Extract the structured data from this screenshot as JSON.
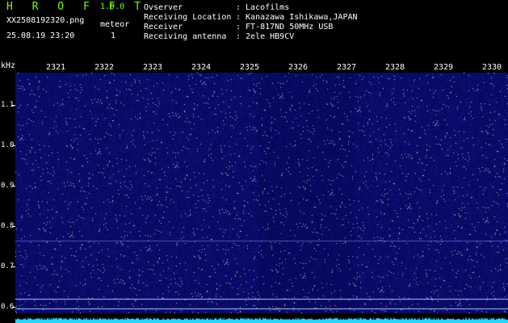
{
  "header": {
    "app_title": "H R O F F T",
    "app_version": "1.0.0",
    "file_name": "XX2508192320.png",
    "meteor_label": "meteor",
    "date_time": "25.08.19 23:20",
    "meteor_count": "1",
    "info": [
      {
        "key": "Ovserver",
        "value": ": Lacofilms"
      },
      {
        "key": "Receiving Location",
        "value": ": Kanazawa Ishikawa,JAPAN"
      },
      {
        "key": "Receiver",
        "value": ": FT-817ND 50MHz USB"
      },
      {
        "key": "Receiving antenna",
        "value": ": 2ele HB9CV"
      }
    ]
  },
  "spectrogram": {
    "unit": "kHz",
    "time_ticks": [
      "2321",
      "2322",
      "2323",
      "2324",
      "2325",
      "2326",
      "2327",
      "2328",
      "2329",
      "2330"
    ],
    "freq_ticks": [
      "1.1",
      "1.0",
      "0.9",
      "0.8",
      "0.7",
      "0.6"
    ],
    "background_color": "#1a1a78",
    "noise_color": "#3b46d8",
    "level_color": "#22d8ff"
  }
}
